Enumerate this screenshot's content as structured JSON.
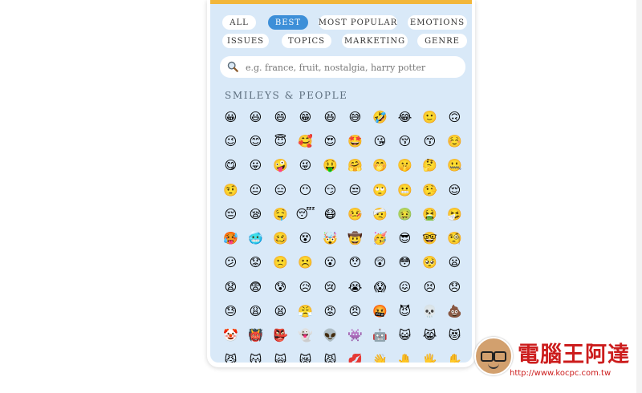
{
  "filters": {
    "row1": [
      {
        "label": "All",
        "active": false
      },
      {
        "label": "Best",
        "active": true
      },
      {
        "label": "Most Popular",
        "active": false
      },
      {
        "label": "Emotions",
        "active": false
      }
    ],
    "row2": [
      {
        "label": "Issues",
        "active": false
      },
      {
        "label": "Topics",
        "active": false
      },
      {
        "label": "Marketing",
        "active": false
      },
      {
        "label": "Genre",
        "active": false
      }
    ]
  },
  "search": {
    "placeholder": "e.g. france, fruit, nostalgia, harry potter",
    "value": ""
  },
  "section": {
    "title": "Smileys & People"
  },
  "emojis": [
    "😀",
    "😃",
    "😄",
    "😁",
    "😆",
    "😅",
    "🤣",
    "😂",
    "🙂",
    "🙃",
    "😉",
    "😊",
    "😇",
    "🥰",
    "😍",
    "🤩",
    "😘",
    "😚",
    "😙",
    "☺️",
    "😋",
    "😛",
    "🤪",
    "😜",
    "🤑",
    "🤗",
    "🤭",
    "🤫",
    "🤔",
    "🤐",
    "🤨",
    "😐",
    "😑",
    "😶",
    "😏",
    "😒",
    "🙄",
    "😬",
    "🤥",
    "😌",
    "😔",
    "😪",
    "🤤",
    "😴",
    "😷",
    "🤒",
    "🤕",
    "🤢",
    "🤮",
    "🤧",
    "🥵",
    "🥶",
    "🥴",
    "😵",
    "🤯",
    "🤠",
    "🥳",
    "😎",
    "🤓",
    "🧐",
    "😕",
    "😟",
    "🙁",
    "☹️",
    "😮",
    "😯",
    "😲",
    "😳",
    "🥺",
    "😦",
    "😧",
    "😨",
    "😰",
    "😥",
    "😢",
    "😭",
    "😱",
    "😖",
    "😣",
    "😞",
    "😓",
    "😩",
    "😫",
    "😤",
    "😡",
    "😠",
    "🤬",
    "😈",
    "💀",
    "💩",
    "🤡",
    "👹",
    "👺",
    "👻",
    "👽",
    "👾",
    "🤖",
    "😺",
    "😹",
    "😻",
    "😼",
    "😽",
    "🙀",
    "😿",
    "😾",
    "💋",
    "👋",
    "🤚",
    "🖐️",
    "✋"
  ],
  "watermark": {
    "title": "電腦王阿達",
    "url": "http://www.kocpc.com.tw"
  },
  "colors": {
    "panel_bg": "#d9e9f8",
    "accent_bar": "#f2b63a",
    "active_chip": "#3d8fd8",
    "watermark_red": "#cc1d1d"
  }
}
